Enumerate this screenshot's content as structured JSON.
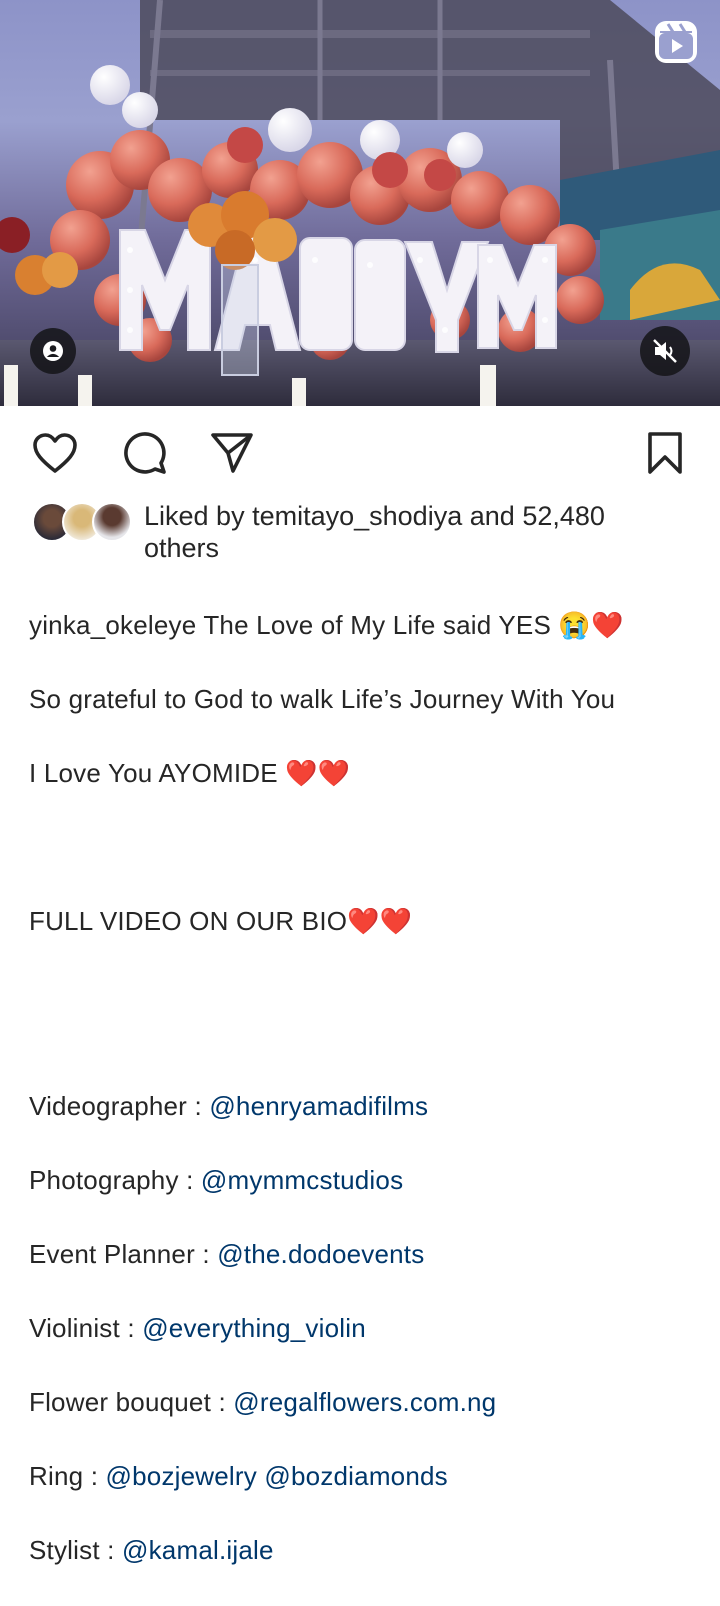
{
  "post": {
    "media": {
      "sign_text": "MARRYME",
      "type_icon": "reels-icon",
      "user_tag_icon": "person-icon",
      "sound_icon": "speaker-muted-icon"
    },
    "actions": [
      "heart-icon",
      "comment-icon",
      "share-icon",
      "bookmark-icon"
    ],
    "likes": {
      "prefix": "Liked by",
      "user": "temitayo_shodiya",
      "joiner": "and",
      "count": "52,480",
      "suffix": "others"
    },
    "caption": {
      "username": "yinka_okeleye",
      "line1_text": "The Love of My Life said YES 😭❤️",
      "line2": "So grateful to God to walk Life’s Journey With You",
      "line3": "I Love You AYOMIDE ❤️❤️",
      "line4": "FULL VIDEO ON OUR BIO❤️❤️",
      "credits": [
        {
          "label": "Videographer : ",
          "mentions": [
            "@henryamadifilms"
          ]
        },
        {
          "label": "Photography : ",
          "mentions": [
            "@mymmcstudios"
          ]
        },
        {
          "label": "Event Planner : ",
          "mentions": [
            "@the.dodoevents"
          ]
        },
        {
          "label": "Violinist : ",
          "mentions": [
            "@everything_violin"
          ]
        },
        {
          "label": "Flower bouquet : ",
          "mentions": [
            "@regalflowers.com.ng"
          ]
        },
        {
          "label": "Ring : ",
          "mentions": [
            "@bozjewelry",
            "@bozdiamonds"
          ]
        },
        {
          "label": "Stylist : ",
          "mentions": [
            "@kamal.ijale"
          ]
        }
      ]
    },
    "colors": {
      "text": "#262626",
      "mention": "#00376b",
      "heart_emoji": "#e0245e"
    }
  }
}
